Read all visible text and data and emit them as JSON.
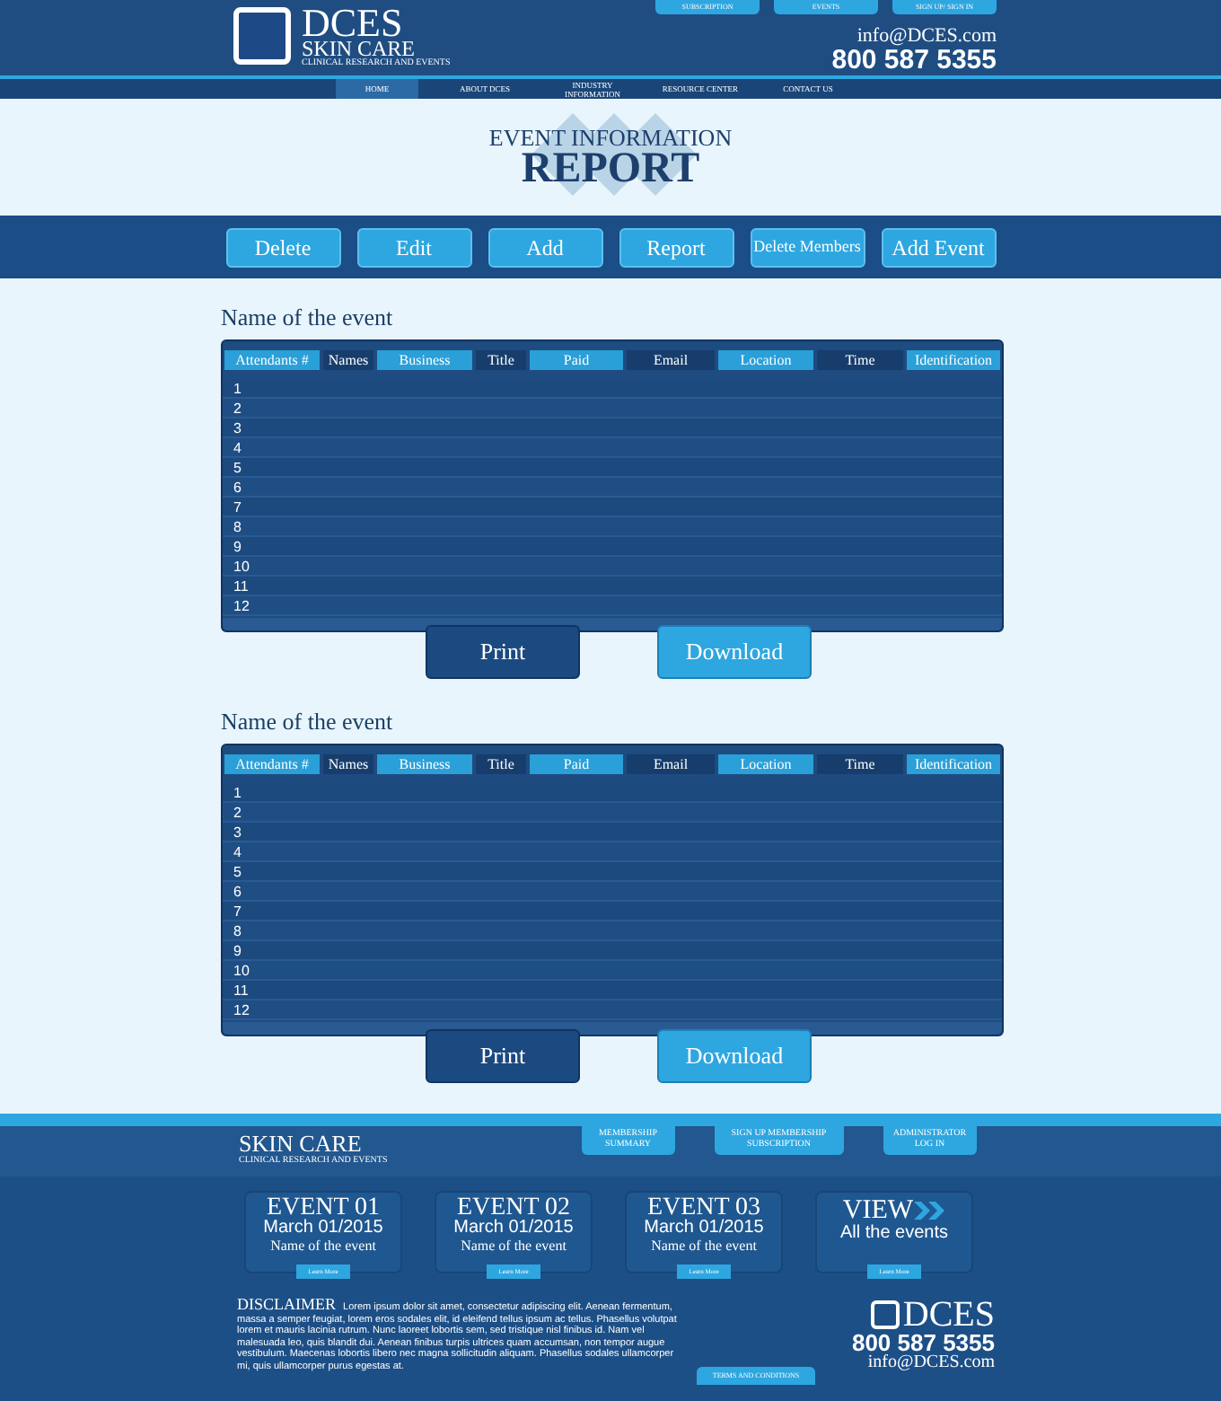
{
  "header": {
    "logo": {
      "name": "DCES",
      "subtitle": "SKIN CARE",
      "tagline": "CLINICAL RESEARCH AND EVENTS"
    },
    "top_links": [
      "SUBSCRIPTION",
      "EVENTS",
      "SIGN UP/ SIGN IN"
    ],
    "email": "info@DCES.com",
    "phone": "800 587 5355",
    "nav": [
      {
        "label": "HOME",
        "selected": true
      },
      {
        "label": "ABOUT DCES",
        "selected": false
      },
      {
        "label": "INDUSTRY INFORMATION",
        "selected": false
      },
      {
        "label": "RESOURCE CENTER",
        "selected": false
      },
      {
        "label": "CONTACT US",
        "selected": false
      }
    ]
  },
  "title": {
    "line_1": "EVENT INFORMATION",
    "line_2": "REPORT"
  },
  "toolbar": [
    "Delete",
    "Edit",
    "Add",
    "Report",
    "Delete Members",
    "Add Event"
  ],
  "events": [
    {
      "heading": "Name of the event",
      "columns": [
        {
          "label": "Attendants #",
          "highlight": true
        },
        {
          "label": "Names",
          "highlight": false
        },
        {
          "label": "Business",
          "highlight": true
        },
        {
          "label": "Title",
          "highlight": false
        },
        {
          "label": "Paid",
          "highlight": true
        },
        {
          "label": "Email",
          "highlight": false
        },
        {
          "label": "Location",
          "highlight": true
        },
        {
          "label": "Time",
          "highlight": false
        },
        {
          "label": "Identification",
          "highlight": true
        }
      ],
      "rows": [
        "1",
        "2",
        "3",
        "4",
        "5",
        "6",
        "7",
        "8",
        "9",
        "10",
        "11",
        "12"
      ],
      "actions": [
        "Print",
        "Download"
      ]
    },
    {
      "heading": "Name of the event",
      "columns": [
        {
          "label": "Attendants #",
          "highlight": true
        },
        {
          "label": "Names",
          "highlight": false
        },
        {
          "label": "Business",
          "highlight": true
        },
        {
          "label": "Title",
          "highlight": false
        },
        {
          "label": "Paid",
          "highlight": true
        },
        {
          "label": "Email",
          "highlight": false
        },
        {
          "label": "Location",
          "highlight": true
        },
        {
          "label": "Time",
          "highlight": false
        },
        {
          "label": "Identification",
          "highlight": true
        }
      ],
      "rows": [
        "1",
        "2",
        "3",
        "4",
        "5",
        "6",
        "7",
        "8",
        "9",
        "10",
        "11",
        "12"
      ],
      "actions": [
        "Print",
        "Download"
      ]
    }
  ],
  "footer": {
    "brand": "SKIN CARE",
    "tagline": "CLINICAL RESEARCH AND EVENTS",
    "links": [
      "MEMBERSHIP SUMMARY",
      "SIGN UP MEMBERSHIP SUBSCRIPTION",
      "ADMINISTRATOR LOG IN"
    ],
    "cards": [
      {
        "kind": "event",
        "title": "EVENT 01",
        "date": "March 01/2015",
        "name": "Name of the event",
        "button": "Learn More"
      },
      {
        "kind": "event",
        "title": "EVENT 02",
        "date": "March 01/2015",
        "name": "Name of the event",
        "button": "Learn More"
      },
      {
        "kind": "event",
        "title": "EVENT 03",
        "date": "March 01/2015",
        "name": "Name of the event",
        "button": "Learn More"
      },
      {
        "kind": "view",
        "title": "VIEW",
        "name": "All the events",
        "button": "Learn More"
      }
    ],
    "disclaimer_title": "DISCLAIMER",
    "disclaimer": "Lorem ipsum dolor sit amet, consectetur adipiscing elit. Aenean fermentum, massa a semper feugiat, lorem eros sodales elit, id eleifend tellus ipsum ac tellus. Phasellus volutpat lorem et mauris lacinia rutrum. Nunc laoreet lobortis sem, sed tristique nisl finibus id. Nam vel malesuada leo, quis blandit dui. Aenean finibus turpis ultrices quam accumsan, non tempor augue vestibulum. Maecenas lobortis libero nec magna sollicitudin aliquam. Phasellus sodales ullamcorper mi, quis ullamcorper purus egestas at.",
    "logo": "DCES",
    "phone": "800 587 5355",
    "email": "info@DCES.com",
    "terms": "TERMS AND CONDITIONS"
  }
}
